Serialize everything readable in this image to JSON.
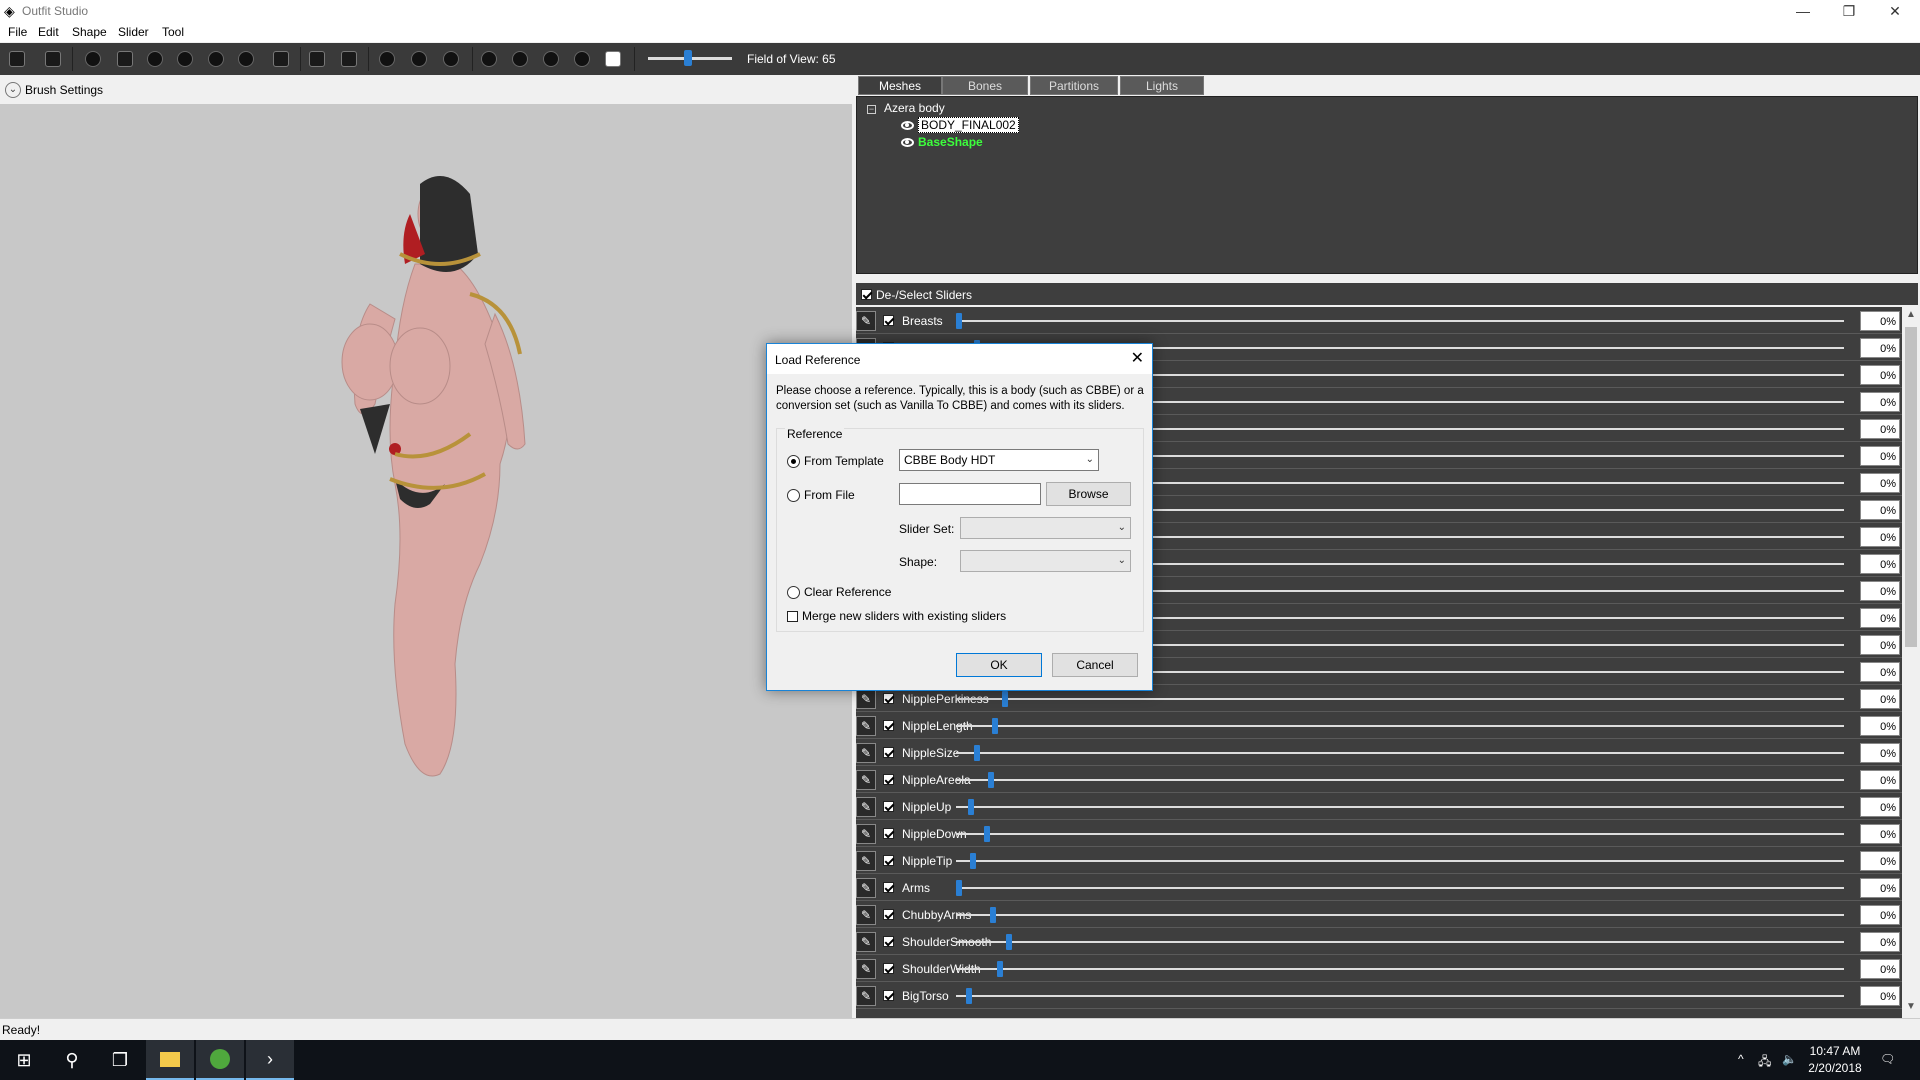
{
  "window": {
    "title": "Outfit Studio",
    "minimize": "—",
    "restore": "❐",
    "close": "✕"
  },
  "menu": [
    "File",
    "Edit",
    "Shape",
    "Slider",
    "Tool"
  ],
  "toolbar": {
    "fov_label": "Field of View: 65",
    "fov_value": 65
  },
  "brush_settings": {
    "label": "Brush Settings",
    "chevron": "⌄"
  },
  "tabs": [
    "Meshes",
    "Bones",
    "Partitions",
    "Lights"
  ],
  "tree": {
    "root": "Azera body",
    "expander": "−",
    "meshes": [
      "BODY_FINAL002",
      "BaseShape"
    ]
  },
  "sliders_header": {
    "label": "De-/Select Sliders"
  },
  "pen_glyph": "✎",
  "sliders": [
    {
      "name": "Breasts",
      "value": "0%",
      "knob": 0.0
    },
    {
      "name": "",
      "value": "0%",
      "knob": 0.02
    },
    {
      "name": "",
      "value": "0%",
      "knob": 0.02
    },
    {
      "name": "",
      "value": "0%",
      "knob": 0.02
    },
    {
      "name": "",
      "value": "0%",
      "knob": 0.02
    },
    {
      "name": "",
      "value": "0%",
      "knob": 0.02
    },
    {
      "name": "",
      "value": "0%",
      "knob": 0.02
    },
    {
      "name": "",
      "value": "0%",
      "knob": 0.02
    },
    {
      "name": "",
      "value": "0%",
      "knob": 0.02
    },
    {
      "name": "",
      "value": "0%",
      "knob": 0.02
    },
    {
      "name": "",
      "value": "0%",
      "knob": 0.02
    },
    {
      "name": "",
      "value": "0%",
      "knob": 0.02
    },
    {
      "name": "",
      "value": "0%",
      "knob": 0.02
    },
    {
      "name": "",
      "value": "0%",
      "knob": 0.02
    },
    {
      "name": "NipplePerkiness",
      "value": "0%",
      "knob": 0.052
    },
    {
      "name": "NippleLength",
      "value": "0%",
      "knob": 0.04
    },
    {
      "name": "NippleSize",
      "value": "0%",
      "knob": 0.02
    },
    {
      "name": "NippleAreola",
      "value": "0%",
      "knob": 0.036
    },
    {
      "name": "NippleUp",
      "value": "0%",
      "knob": 0.014
    },
    {
      "name": "NippleDown",
      "value": "0%",
      "knob": 0.032
    },
    {
      "name": "NippleTip",
      "value": "0%",
      "knob": 0.016
    },
    {
      "name": "Arms",
      "value": "0%",
      "knob": 0.0
    },
    {
      "name": "ChubbyArms",
      "value": "0%",
      "knob": 0.038
    },
    {
      "name": "ShoulderSmooth",
      "value": "0%",
      "knob": 0.056
    },
    {
      "name": "ShoulderWidth",
      "value": "0%",
      "knob": 0.046
    },
    {
      "name": "BigTorso",
      "value": "0%",
      "knob": 0.011
    }
  ],
  "status": "Ready!",
  "dialog": {
    "title": "Load Reference",
    "close": "✕",
    "description": "Please choose a reference. Typically, this is a body (such as CBBE) or a conversion set (such as Vanilla To CBBE) and comes with its sliders.",
    "group_label": "Reference",
    "from_template_label": "From Template",
    "from_template_value": "CBBE Body HDT",
    "from_file_label": "From File",
    "from_file_value": "",
    "browse_label": "Browse",
    "slider_set_label": "Slider Set:",
    "slider_set_value": "",
    "shape_label": "Shape:",
    "shape_value": "",
    "clear_reference_label": "Clear Reference",
    "merge_label": "Merge new sliders with existing sliders",
    "ok_label": "OK",
    "cancel_label": "Cancel",
    "dropdown_arrow": "⌄"
  },
  "taskbar": {
    "start": "⊞",
    "search": "⚲",
    "task_view": "❐",
    "time": "10:47 AM",
    "date": "2/20/2018",
    "tray_up": "^",
    "network": "🖧",
    "volume": "🔈",
    "notifications": "🗨"
  },
  "colors": {
    "accent": "#2a7fd4",
    "panel_dark": "#3e3e3e",
    "active_mesh": "#3cff3c",
    "dialog_border": "#1883d7"
  }
}
